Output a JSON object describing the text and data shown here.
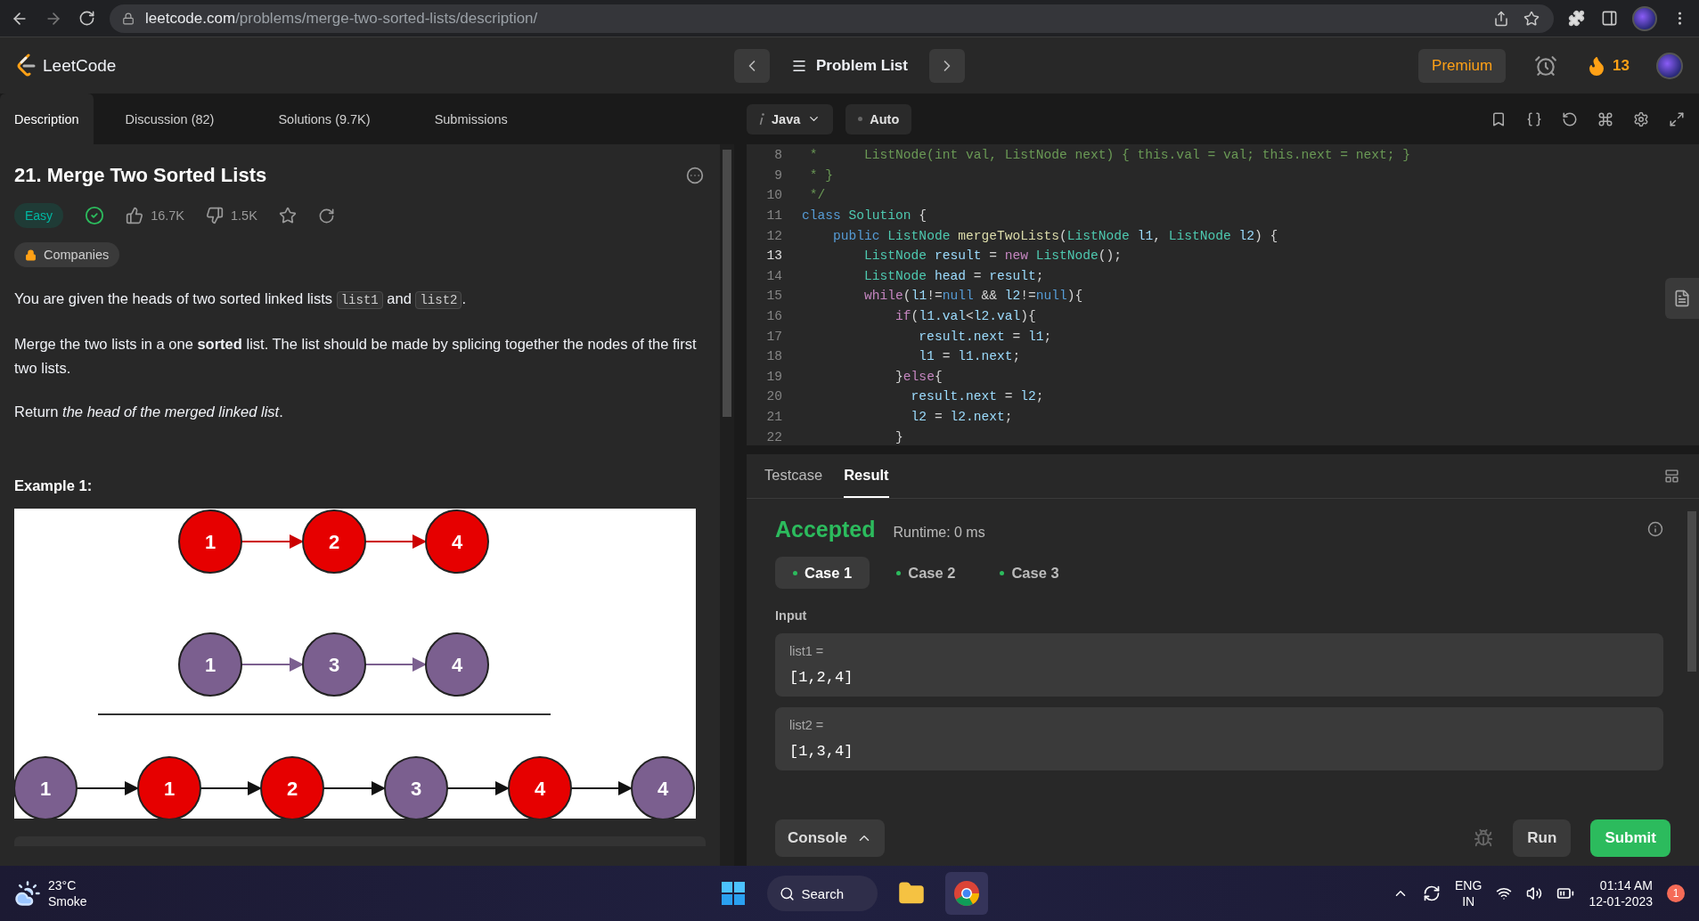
{
  "browser": {
    "url_host": "leetcode.com",
    "url_path": "/problems/merge-two-sorted-lists/description/"
  },
  "header": {
    "brand": "LeetCode",
    "problem_list": "Problem List",
    "premium": "Premium",
    "streak": "13"
  },
  "tabs": [
    {
      "label": "Description",
      "selected": true
    },
    {
      "label": "Discussion (82)",
      "selected": false
    },
    {
      "label": "Solutions (9.7K)",
      "selected": false
    },
    {
      "label": "Submissions",
      "selected": false
    }
  ],
  "problem": {
    "title": "21. Merge Two Sorted Lists",
    "difficulty": "Easy",
    "solved": true,
    "likes": "16.7K",
    "dislikes": "1.5K",
    "companies": "Companies",
    "paragraphs": [
      [
        {
          "text": "You are given the heads of two sorted linked lists ",
          "kind": "text"
        },
        {
          "text": "list1",
          "kind": "code"
        },
        {
          "text": " and ",
          "kind": "text"
        },
        {
          "text": "list2",
          "kind": "code"
        },
        {
          "text": ".",
          "kind": "text"
        }
      ],
      [
        {
          "text": "Merge the two lists in a one **sorted** list. The list should be made by splicing together the nodes of the first two lists.",
          "kind": "text"
        }
      ],
      [
        {
          "text": "Return *the head of the merged linked list*.",
          "kind": "text"
        }
      ]
    ],
    "example_title": "Example 1:",
    "example_diagram": [
      [
        {
          "label": "1",
          "color": "#e60000"
        },
        {
          "label": "2",
          "color": "#e60000"
        },
        {
          "label": "4",
          "color": "#e60000"
        }
      ],
      [
        {
          "label": "1",
          "color": "#7b5f8f"
        },
        {
          "label": "3",
          "color": "#7b5f8f"
        },
        {
          "label": "4",
          "color": "#7b5f8f"
        }
      ],
      [
        {
          "label": "1",
          "color": "#7b5f8f"
        },
        {
          "label": "1",
          "color": "#e60000"
        },
        {
          "label": "2",
          "color": "#e60000"
        },
        {
          "label": "3",
          "color": "#7b5f8f"
        },
        {
          "label": "4",
          "color": "#e60000"
        },
        {
          "label": "4",
          "color": "#7b5f8f"
        }
      ]
    ]
  },
  "editor": {
    "language": "Java",
    "mode": "Auto",
    "lines": [
      {
        "number": "8",
        "current": false,
        "tokens": [
          {
            "text": " *      ListNode(int val, ListNode next) { this.val = val; this.next = next; }",
            "kind": "comment"
          }
        ]
      },
      {
        "number": "9",
        "current": false,
        "tokens": [
          {
            "text": " * }",
            "kind": "comment"
          }
        ]
      },
      {
        "number": "10",
        "current": false,
        "tokens": [
          {
            "text": " */",
            "kind": "comment"
          }
        ]
      },
      {
        "number": "11",
        "current": false,
        "tokens": [
          {
            "text": "class ",
            "kind": "keyword"
          },
          {
            "text": "Solution",
            "kind": "type"
          },
          {
            "text": " {",
            "kind": "plain"
          }
        ]
      },
      {
        "number": "12",
        "current": false,
        "tokens": [
          {
            "text": "    public ",
            "kind": "keyword"
          },
          {
            "text": "ListNode ",
            "kind": "type"
          },
          {
            "text": "mergeTwoLists",
            "kind": "function"
          },
          {
            "text": "(",
            "kind": "plain"
          },
          {
            "text": "ListNode ",
            "kind": "type"
          },
          {
            "text": "l1",
            "kind": "variable"
          },
          {
            "text": ", ",
            "kind": "plain"
          },
          {
            "text": "ListNode ",
            "kind": "type"
          },
          {
            "text": "l2",
            "kind": "variable"
          },
          {
            "text": ") {",
            "kind": "plain"
          }
        ]
      },
      {
        "number": "13",
        "current": true,
        "tokens": [
          {
            "text": "        ListNode ",
            "kind": "type"
          },
          {
            "text": "result",
            "kind": "variable"
          },
          {
            "text": " = ",
            "kind": "plain"
          },
          {
            "text": "new ",
            "kind": "control"
          },
          {
            "text": "ListNode",
            "kind": "type"
          },
          {
            "text": "();",
            "kind": "plain"
          }
        ]
      },
      {
        "number": "14",
        "current": false,
        "tokens": [
          {
            "text": "        ListNode ",
            "kind": "type"
          },
          {
            "text": "head",
            "kind": "variable"
          },
          {
            "text": " = ",
            "kind": "plain"
          },
          {
            "text": "result",
            "kind": "variable"
          },
          {
            "text": ";",
            "kind": "plain"
          }
        ]
      },
      {
        "number": "15",
        "current": false,
        "tokens": [
          {
            "text": "        while",
            "kind": "control"
          },
          {
            "text": "(",
            "kind": "plain"
          },
          {
            "text": "l1",
            "kind": "variable"
          },
          {
            "text": "!=",
            "kind": "plain"
          },
          {
            "text": "null",
            "kind": "keyword"
          },
          {
            "text": " && ",
            "kind": "plain"
          },
          {
            "text": "l2",
            "kind": "variable"
          },
          {
            "text": "!=",
            "kind": "plain"
          },
          {
            "text": "null",
            "kind": "keyword"
          },
          {
            "text": "){",
            "kind": "plain"
          }
        ]
      },
      {
        "number": "16",
        "current": false,
        "tokens": [
          {
            "text": "            if",
            "kind": "control"
          },
          {
            "text": "(",
            "kind": "plain"
          },
          {
            "text": "l1.val",
            "kind": "variable"
          },
          {
            "text": "<",
            "kind": "plain"
          },
          {
            "text": "l2.val",
            "kind": "variable"
          },
          {
            "text": "){",
            "kind": "plain"
          }
        ]
      },
      {
        "number": "17",
        "current": false,
        "tokens": [
          {
            "text": "               result.next",
            "kind": "variable"
          },
          {
            "text": " = ",
            "kind": "plain"
          },
          {
            "text": "l1",
            "kind": "variable"
          },
          {
            "text": ";",
            "kind": "plain"
          }
        ]
      },
      {
        "number": "18",
        "current": false,
        "tokens": [
          {
            "text": "               l1",
            "kind": "variable"
          },
          {
            "text": " = ",
            "kind": "plain"
          },
          {
            "text": "l1.next",
            "kind": "variable"
          },
          {
            "text": ";",
            "kind": "plain"
          }
        ]
      },
      {
        "number": "19",
        "current": false,
        "tokens": [
          {
            "text": "            }",
            "kind": "plain"
          },
          {
            "text": "else",
            "kind": "control"
          },
          {
            "text": "{",
            "kind": "plain"
          }
        ]
      },
      {
        "number": "20",
        "current": false,
        "tokens": [
          {
            "text": "              result.next",
            "kind": "variable"
          },
          {
            "text": " = ",
            "kind": "plain"
          },
          {
            "text": "l2",
            "kind": "variable"
          },
          {
            "text": ";",
            "kind": "plain"
          }
        ]
      },
      {
        "number": "21",
        "current": false,
        "tokens": [
          {
            "text": "              l2",
            "kind": "variable"
          },
          {
            "text": " = ",
            "kind": "plain"
          },
          {
            "text": "l2.next",
            "kind": "variable"
          },
          {
            "text": ";",
            "kind": "plain"
          }
        ]
      },
      {
        "number": "22",
        "current": false,
        "tokens": [
          {
            "text": "            }",
            "kind": "plain"
          }
        ]
      }
    ]
  },
  "result_panel": {
    "tabs": [
      {
        "label": "Testcase",
        "selected": false
      },
      {
        "label": "Result",
        "selected": true
      }
    ],
    "verdict": "Accepted",
    "runtime": "Runtime: 0 ms",
    "cases": [
      {
        "label": "Case 1",
        "selected": true,
        "color": "#2cbb5d"
      },
      {
        "label": "Case 2",
        "selected": false,
        "color": "#2cbb5d"
      },
      {
        "label": "Case 3",
        "selected": false,
        "color": "#2cbb5d"
      }
    ],
    "input_label": "Input",
    "inputs": [
      {
        "name": "list1 =",
        "value": "[1,2,4]"
      },
      {
        "name": "list2 =",
        "value": "[1,3,4]"
      }
    ],
    "console": "Console",
    "run": "Run",
    "submit": "Submit"
  },
  "taskbar": {
    "temperature": "23°C",
    "weather": "Smoke",
    "search": "Search",
    "language": "ENG",
    "region": "IN",
    "time": "01:14 AM",
    "date": "12-01-2023",
    "notifications": "1"
  }
}
